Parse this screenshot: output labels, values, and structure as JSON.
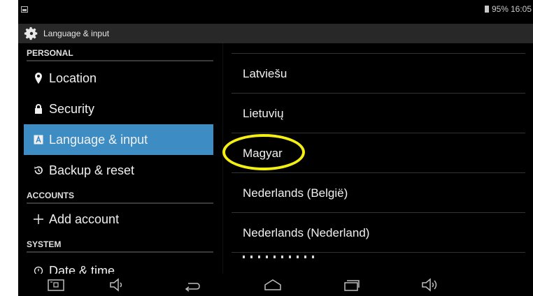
{
  "status": {
    "battery": "95%",
    "time": "16:05"
  },
  "actionbar": {
    "title": "Language & input"
  },
  "sidebar": {
    "sections": {
      "personal": "PERSONAL",
      "accounts": "ACCOUNTS",
      "system": "SYSTEM"
    },
    "items": [
      {
        "label": "Location",
        "icon": "location-pin-icon"
      },
      {
        "label": "Security",
        "icon": "lock-icon"
      },
      {
        "label": "Language & input",
        "icon": "keyboard-a-icon",
        "selected": true
      },
      {
        "label": "Backup & reset",
        "icon": "restore-icon"
      },
      {
        "label": "Add account",
        "icon": "plus-icon"
      },
      {
        "label": "Date & time",
        "icon": "clock-icon"
      }
    ]
  },
  "languages": [
    "Latviešu",
    "Lietuvių",
    "Magyar",
    "Nederlands (België)",
    "Nederlands (Nederland)"
  ],
  "colors": {
    "selected": "#3d8cc4",
    "highlight": "#f4ef12",
    "actionbar": "#282828"
  },
  "navbar": {
    "buttons": [
      "screenshot-icon",
      "volume-down-icon",
      "back-icon",
      "home-icon",
      "recents-icon",
      "volume-up-icon"
    ]
  }
}
